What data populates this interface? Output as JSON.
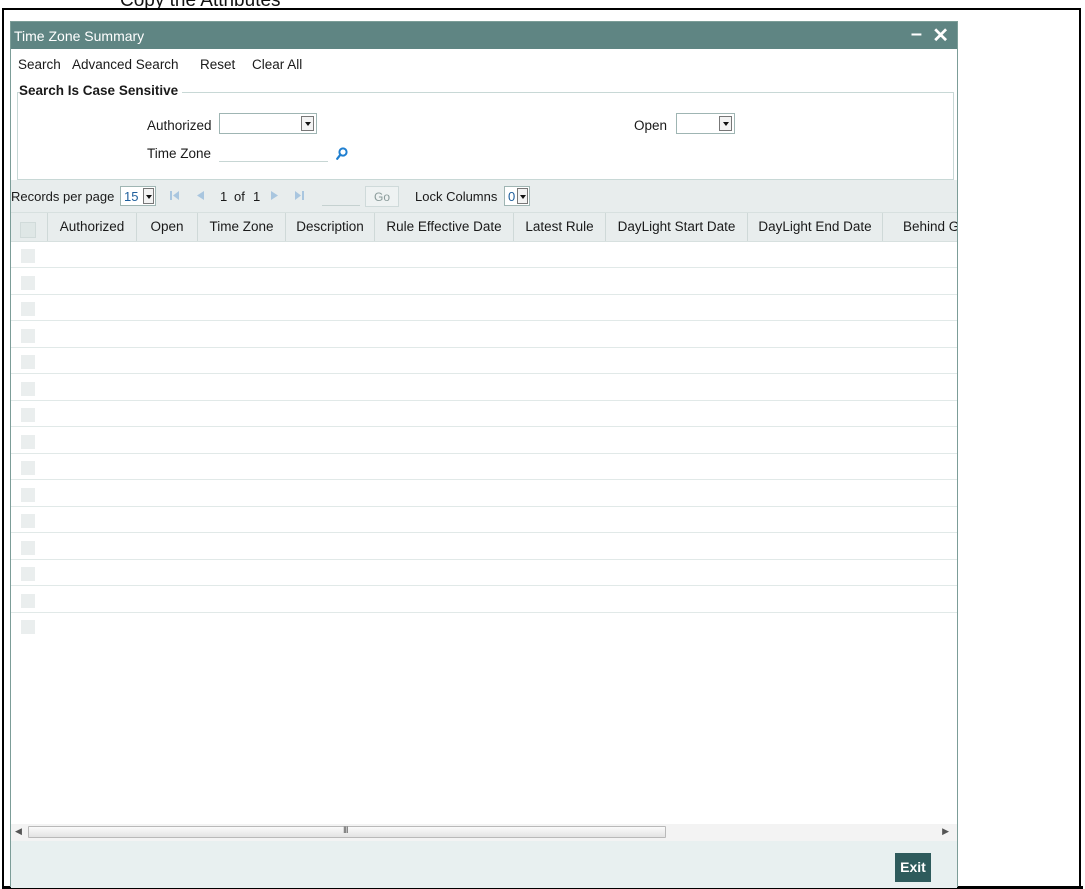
{
  "document": {
    "heading_fragment": "Copy the Attributes"
  },
  "window": {
    "title": "Time Zone Summary",
    "minimize_glyph": "–",
    "close_glyph": "✕"
  },
  "menu": {
    "search": "Search",
    "advanced_search": "Advanced Search",
    "reset": "Reset",
    "clear_all": "Clear All"
  },
  "criteria": {
    "legend": "Search Is Case Sensitive",
    "authorized_label": "Authorized",
    "authorized_value": "",
    "open_label": "Open",
    "open_value": "",
    "time_zone_label": "Time Zone",
    "time_zone_value": ""
  },
  "pager": {
    "records_label": "Records per page",
    "records_value": "15",
    "page_current": "1",
    "of_label": "of",
    "page_total": "1",
    "go_label": "Go",
    "lock_label": "Lock Columns",
    "lock_value": "0"
  },
  "grid": {
    "columns": [
      "Authorized",
      "Open",
      "Time Zone",
      "Description",
      "Rule Effective Date",
      "Latest Rule",
      "DayLight Start Date",
      "DayLight End Date",
      "Behind G"
    ]
  },
  "scrollbar": {
    "grip": "III"
  },
  "footer": {
    "exit_label": "Exit"
  },
  "colors": {
    "title_bar": "#5f8583",
    "exit_button": "#2e5b5c",
    "toolbar_bg": "#e8eded",
    "accent_blue": "#1f5f9c"
  }
}
